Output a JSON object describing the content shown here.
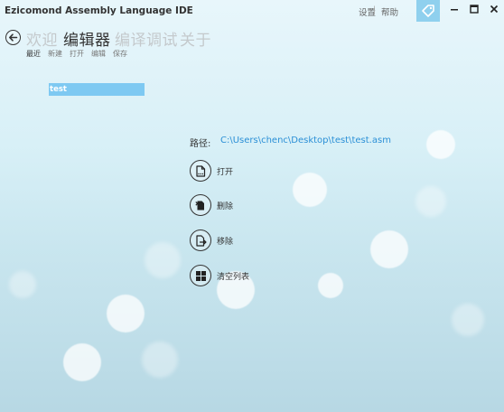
{
  "window": {
    "title": "Ezicomond Assembly Language IDE",
    "settings": "设置",
    "separator": "|",
    "help": "帮助"
  },
  "nav": {
    "tabs": [
      {
        "label": "欢迎",
        "active": false
      },
      {
        "label": "编辑器",
        "active": true
      },
      {
        "label": "编译调试",
        "active": false
      },
      {
        "label": "关于",
        "active": false
      }
    ],
    "subtabs": [
      {
        "label": "最近",
        "active": true
      },
      {
        "label": "新建",
        "active": false
      },
      {
        "label": "打开",
        "active": false
      },
      {
        "label": "编辑",
        "active": false
      },
      {
        "label": "保存",
        "active": false
      }
    ]
  },
  "recent_files": [
    {
      "name": "test"
    }
  ],
  "details": {
    "path_label": "路径:",
    "path_value": "C:\\Users\\chenc\\Desktop\\test\\test.asm",
    "actions": [
      {
        "label": "打开",
        "icon": "file-open-icon"
      },
      {
        "label": "删除",
        "icon": "file-delete-icon"
      },
      {
        "label": "移除",
        "icon": "file-remove-icon"
      },
      {
        "label": "清空列表",
        "icon": "clear-list-icon"
      }
    ]
  },
  "colors": {
    "accent": "#7ec9f2",
    "link": "#2b8fd6",
    "tag_button": "#8fd0ee"
  }
}
